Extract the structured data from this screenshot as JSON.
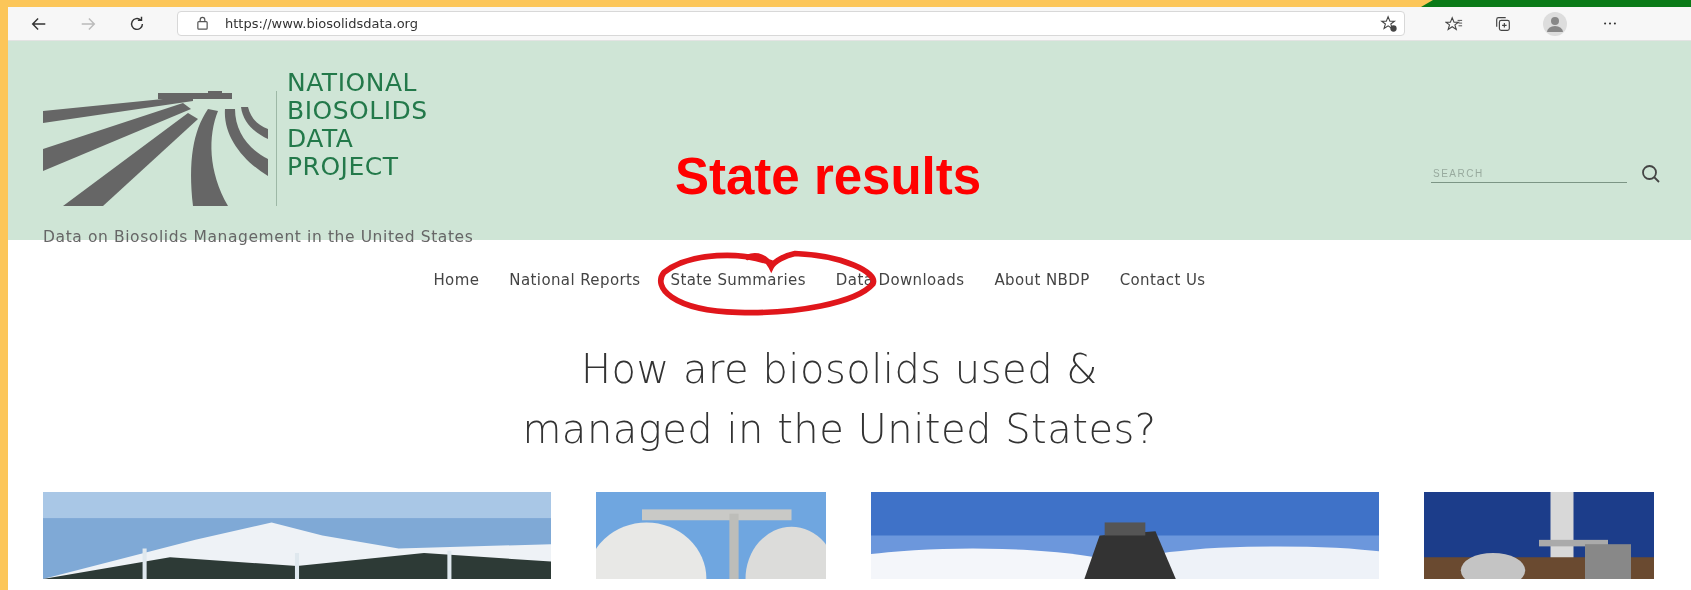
{
  "browser": {
    "address": "https://www.biosolidsdata.org"
  },
  "header": {
    "logo_lines": [
      "NATIONAL",
      "BIOSOLIDS",
      "DATA",
      "PROJECT"
    ],
    "tagline": "Data on Biosolids Management in the United States",
    "search": {
      "placeholder": "SEARCH"
    }
  },
  "annotation": {
    "text": "State results"
  },
  "nav": [
    {
      "label": "Home",
      "circled": false
    },
    {
      "label": "National Reports",
      "circled": false
    },
    {
      "label": "State Summaries",
      "circled": true
    },
    {
      "label": "Data Downloads",
      "circled": false
    },
    {
      "label": "About NBDP",
      "circled": false
    },
    {
      "label": "Contact Us",
      "circled": false
    }
  ],
  "heading_lines": [
    "How are biosolids used &",
    "managed in the United States?"
  ]
}
